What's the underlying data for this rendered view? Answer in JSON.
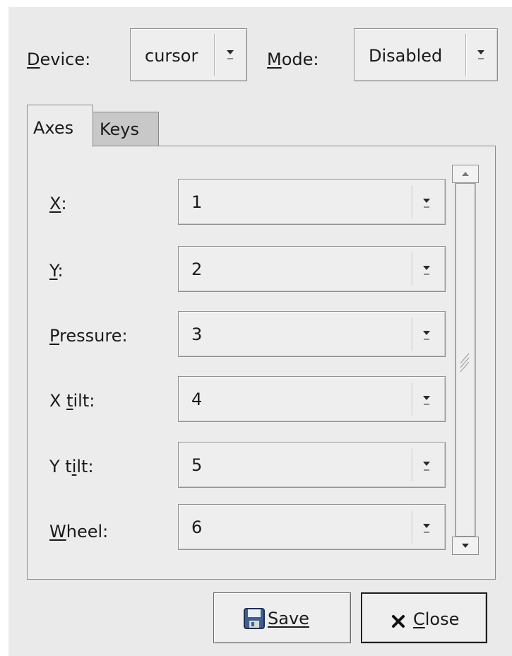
{
  "header": {
    "device_label": "Device:",
    "device_value": "cursor",
    "mode_label": "Mode:",
    "mode_value": "Disabled"
  },
  "tabs": [
    {
      "label": "Axes",
      "active": true
    },
    {
      "label": "Keys",
      "active": false
    }
  ],
  "axes": [
    {
      "label": "X:",
      "value": "1"
    },
    {
      "label": "Y:",
      "value": "2"
    },
    {
      "label": "Pressure:",
      "value": "3"
    },
    {
      "label": "X tilt:",
      "value": "4"
    },
    {
      "label": "Y tilt:",
      "value": "5"
    },
    {
      "label": "Wheel:",
      "value": "6"
    }
  ],
  "buttons": {
    "save_label": "Save",
    "close_label": "Close"
  },
  "icons": {
    "dropdown": "chevron-down-icon",
    "save": "floppy-disk-icon",
    "close": "x-mark-icon",
    "scroll_up": "arrow-up-icon",
    "scroll_down": "arrow-down-icon"
  }
}
